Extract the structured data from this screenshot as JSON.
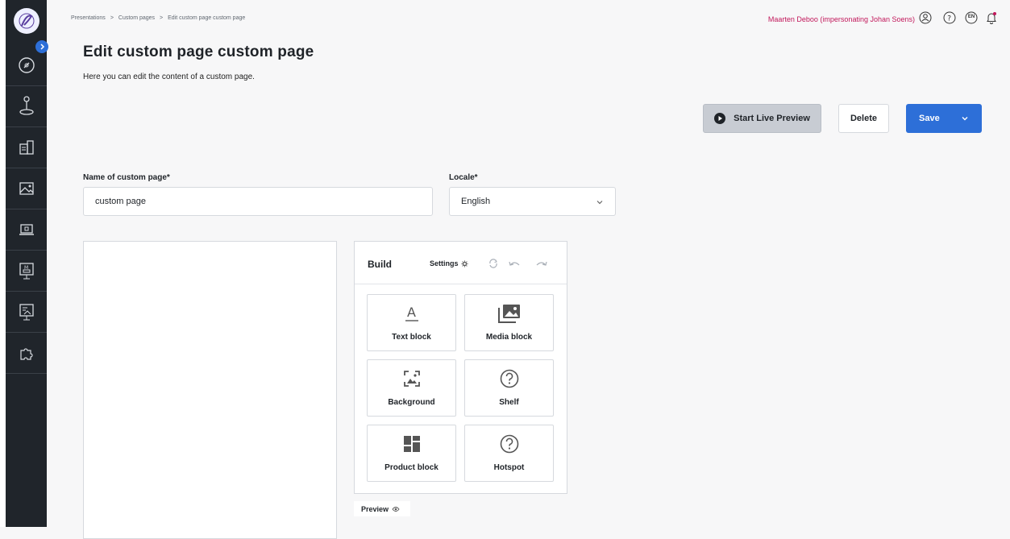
{
  "breadcrumb": [
    "Presentations",
    "Custom pages",
    "Edit custom page custom page"
  ],
  "breadcrumb_separator": ">",
  "user": {
    "label": "Maarten Deboo (impersonating Johan Soens)",
    "language": "EN"
  },
  "page": {
    "title": "Edit custom page custom page",
    "description": "Here you can edit the content of a custom page."
  },
  "actions": {
    "preview_label": "Start Live Preview",
    "delete_label": "Delete",
    "save_label": "Save"
  },
  "form": {
    "name_label": "Name of custom page*",
    "name_value": "custom page",
    "locale_label": "Locale*",
    "locale_value": "English"
  },
  "build": {
    "title": "Build",
    "settings_label": "Settings",
    "blocks": [
      "Text block",
      "Media block",
      "Background",
      "Shelf",
      "Product block",
      "Hotspot"
    ]
  },
  "preview_tab": "Preview",
  "sidebar_icons": [
    "dashboard-icon",
    "joystick-icon",
    "products-icon",
    "media-icon",
    "laptop-icon",
    "presentation-m-icon",
    "presentation-chart-icon",
    "puzzle-icon"
  ],
  "colors": {
    "accent": "#2d6fd8",
    "sidebar": "#20252b",
    "user": "#c2185b"
  }
}
